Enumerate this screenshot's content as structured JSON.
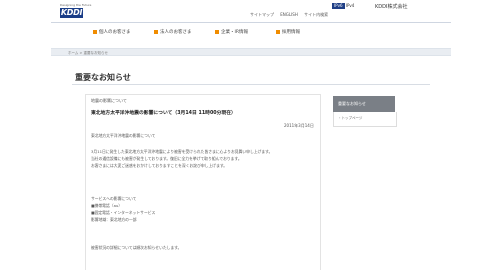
{
  "header": {
    "logo_tagline": "Designing the Future",
    "logo_text": "KDDI",
    "top_links": [
      "サイトマップ",
      "ENGLISH",
      "サイト内検索"
    ],
    "ipv6_badge": "IPv6",
    "ipv6_label": "IPv4",
    "corp_name": "KDDI株式会社"
  },
  "nav": {
    "items": [
      "個人のお客さま",
      "法人のお客さま",
      "企業・IR情報",
      "採用情報"
    ]
  },
  "breadcrumb": "ホーム > 重要なお知らせ",
  "page": {
    "title": "重要なお知らせ",
    "subtitle": "地震の影響について",
    "headline": "東北地方太平洋沖地震の影響について（3月14日 11時00分現在）",
    "date": "2011年3月14日",
    "body_lines": [
      "東北地方太平洋沖地震の影響について",
      "3月11日に発生した東北地方太平洋沖地震により被害を受けられた皆さまに心よりお見舞い申し上げます。",
      "当社の通信設備にも被害が発生しております。復旧に全力を挙げて取り組んでおります。",
      "お客さまには大変ご迷惑をおかけしておりますことを深くお詫び申し上げます。",
      "",
      "サービスへの影響について",
      "■携帯電話（au）",
      "■固定電話・インターネットサービス",
      "影響地域：東北地方の一部",
      "",
      "被害状況の詳細については順次お知らせいたします。"
    ]
  },
  "sidebar": {
    "heading": "重要なお知らせ",
    "item": "・トップページ"
  }
}
